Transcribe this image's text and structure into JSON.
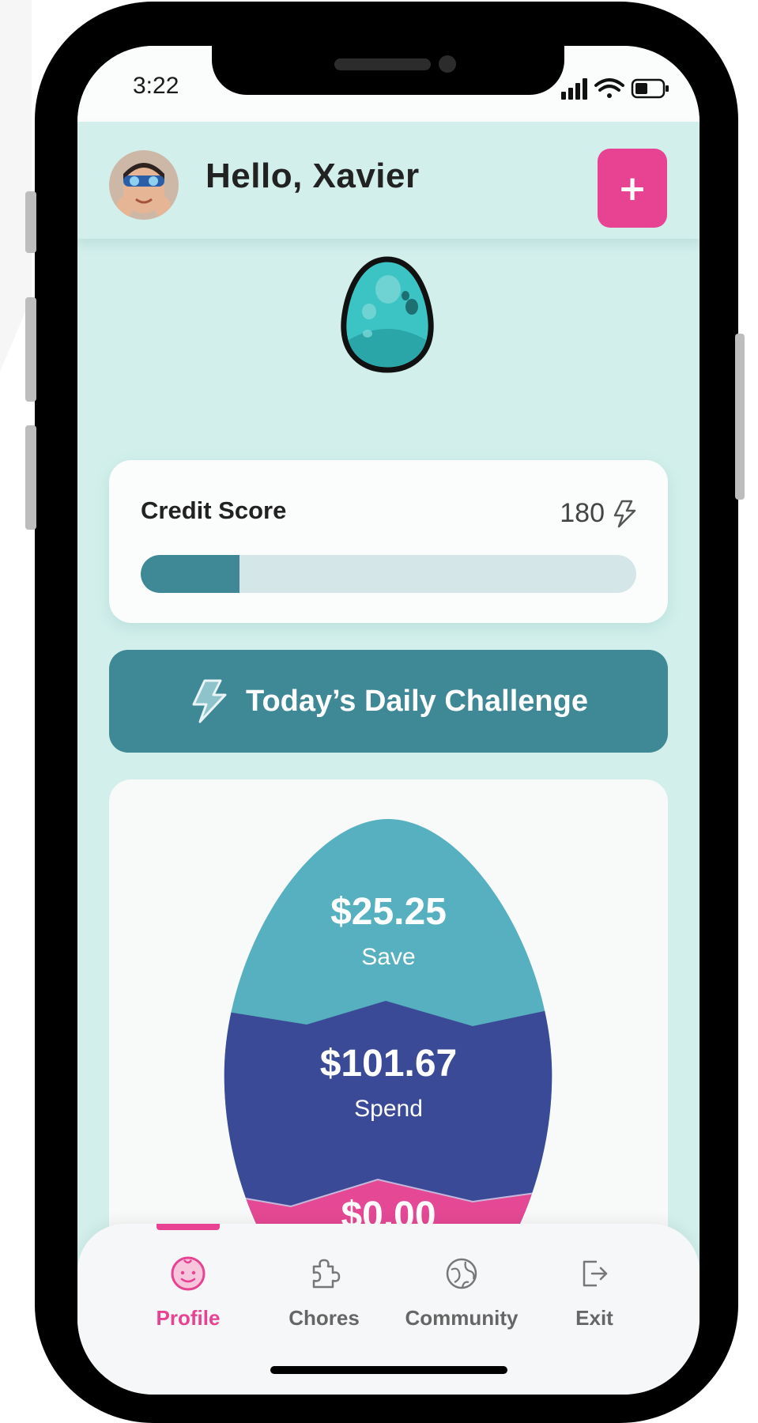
{
  "status_bar": {
    "time": "3:22"
  },
  "header": {
    "greeting": "Hello, Xavier",
    "add_label": "+"
  },
  "credit_score": {
    "label": "Credit Score",
    "value": "180",
    "progress_fraction": 0.2
  },
  "daily_challenge": {
    "label": "Today’s Daily Challenge"
  },
  "balances": {
    "save": {
      "amount": "$25.25",
      "label": "Save"
    },
    "spend": {
      "amount": "$101.67",
      "label": "Spend"
    },
    "third": {
      "amount": "$0.00"
    }
  },
  "tabs": [
    {
      "label": "Profile",
      "icon": "smiley-face-icon",
      "active": true
    },
    {
      "label": "Chores",
      "icon": "puzzle-piece-icon",
      "active": false
    },
    {
      "label": "Community",
      "icon": "globe-icon",
      "active": false
    },
    {
      "label": "Exit",
      "icon": "logout-icon",
      "active": false
    }
  ],
  "colors": {
    "accent_pink": "#e84393",
    "teal_dark": "#3f8895",
    "teal_light": "#d2efeb",
    "save_color": "#56b0bf",
    "spend_color": "#3a4a96",
    "third_color": "#e54894"
  }
}
